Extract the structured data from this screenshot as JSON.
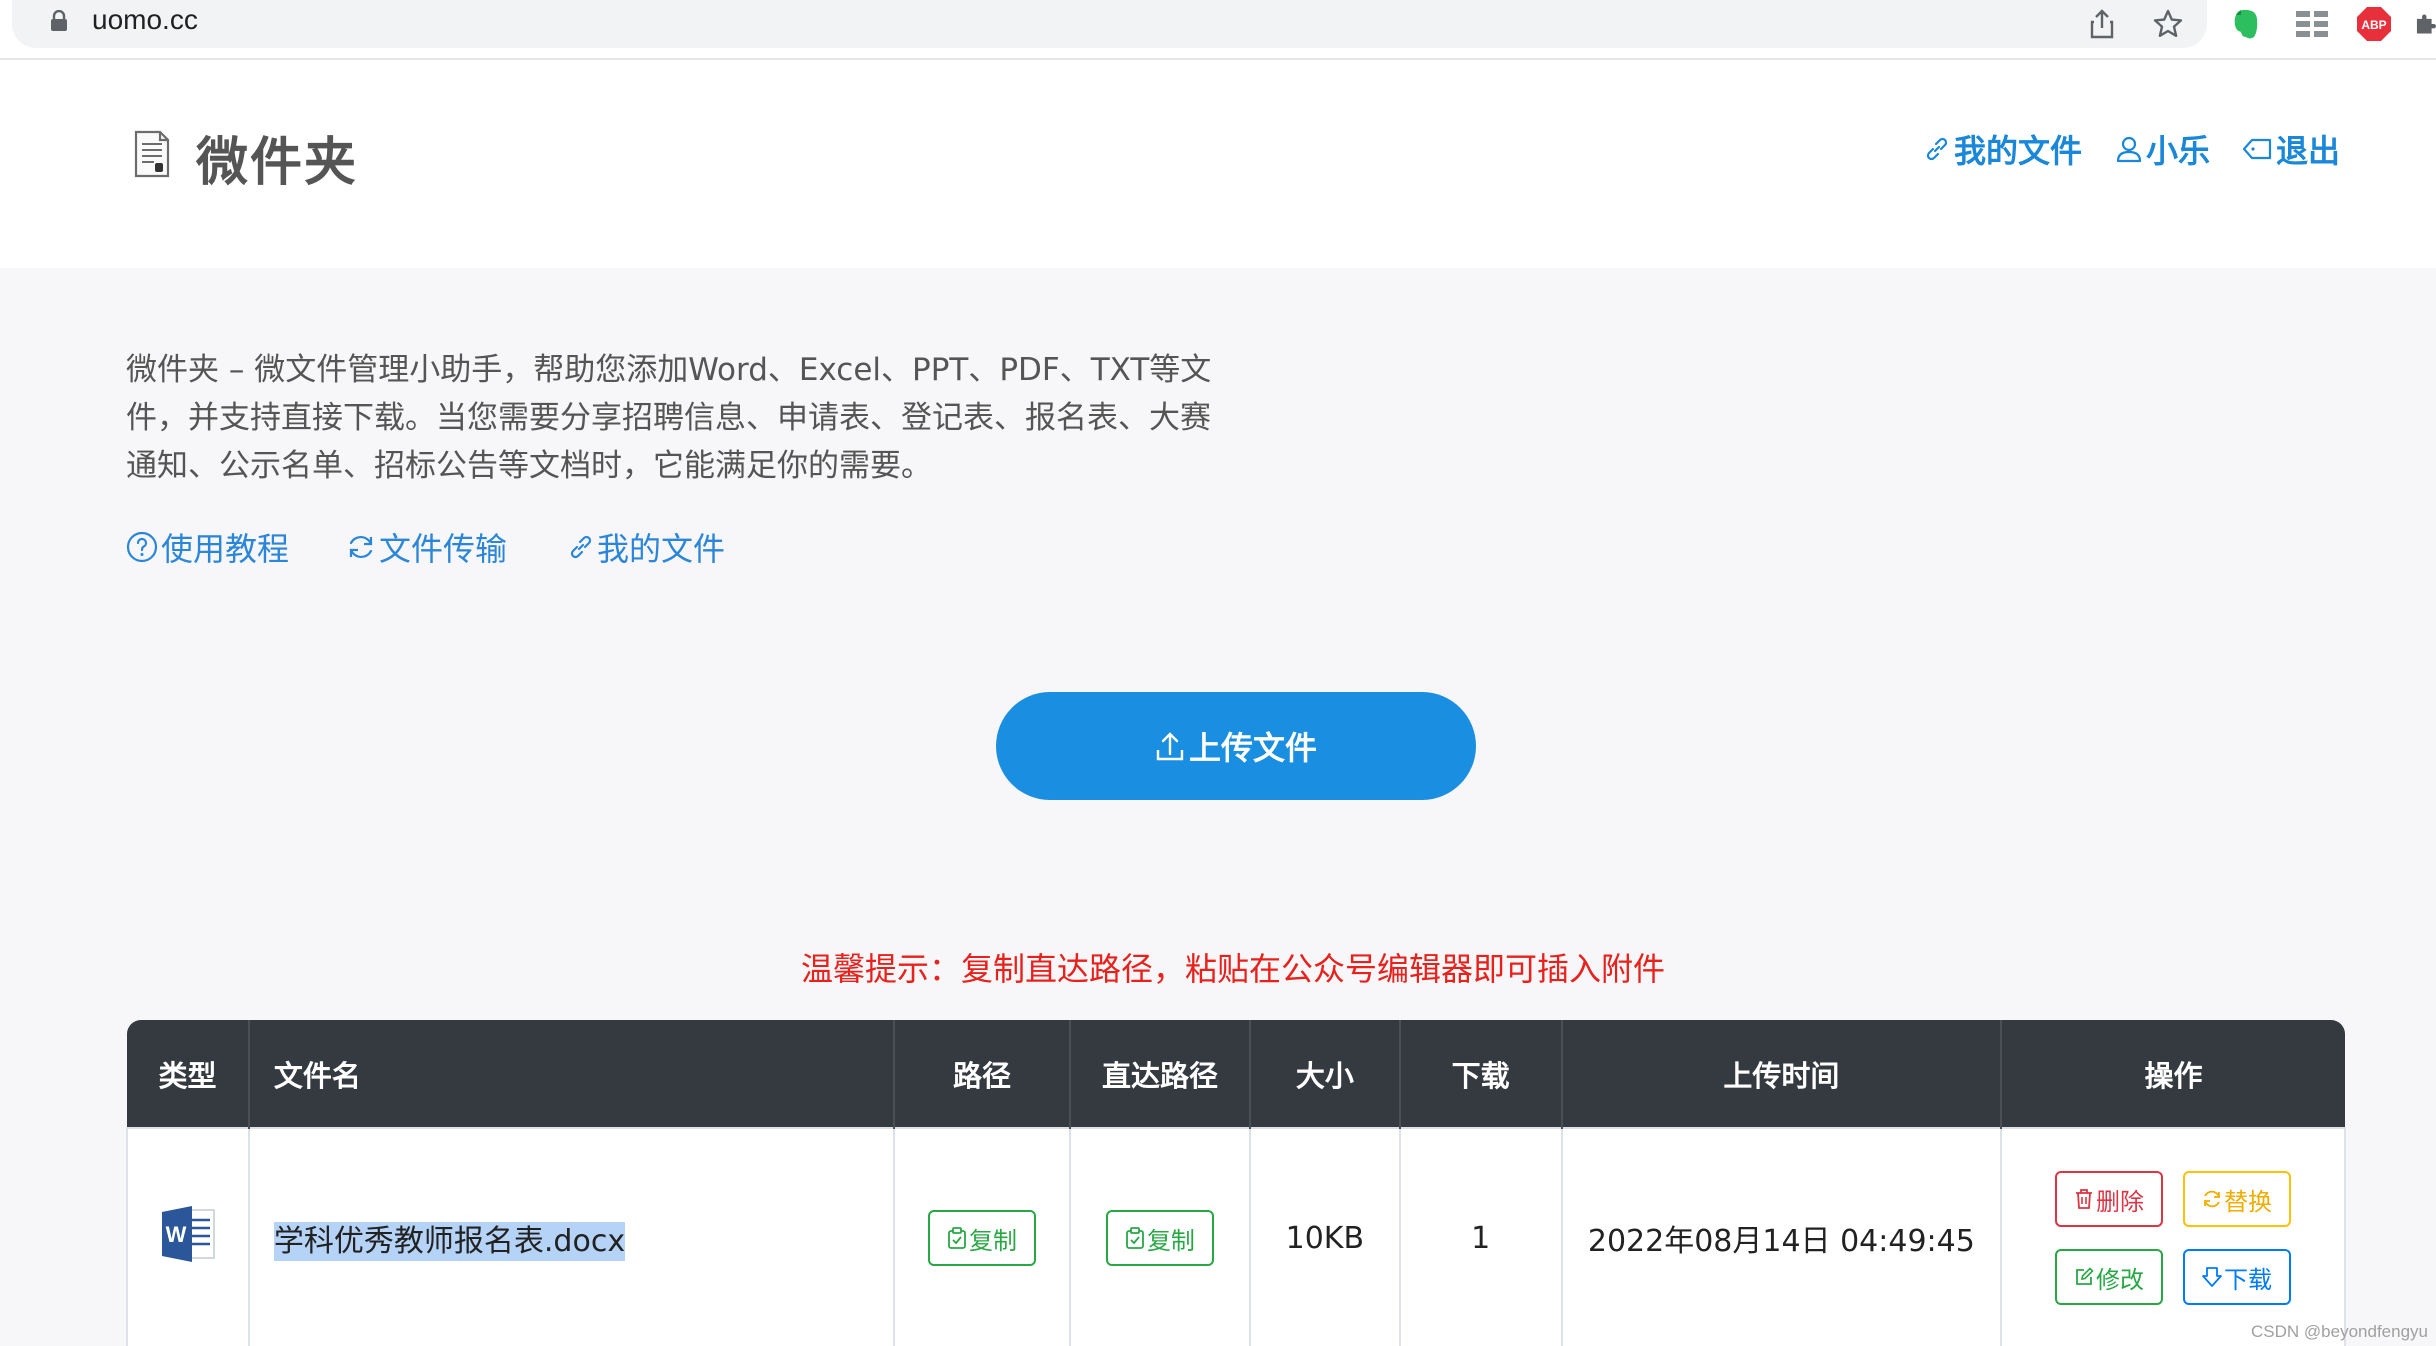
{
  "browser": {
    "url": "uomo.cc"
  },
  "header": {
    "title": "微件夹",
    "nav": {
      "my_files": "我的文件",
      "user": "小乐",
      "logout": "退出"
    }
  },
  "intro": {
    "description": "微件夹 – 微文件管理小助手，帮助您添加Word、Excel、PPT、PDF、TXT等文件，并支持直接下载。当您需要分享招聘信息、申请表、登记表、报名表、大赛通知、公示名单、招标公告等文档时，它能满足你的需要。",
    "links": {
      "tutorial": "使用教程",
      "transfer": "文件传输",
      "my_files": "我的文件"
    }
  },
  "upload": {
    "label": "上传文件"
  },
  "tip": "温馨提示：复制直达路径，粘贴在公众号编辑器即可插入附件",
  "table": {
    "headers": {
      "type": "类型",
      "filename": "文件名",
      "path": "路径",
      "direct_path": "直达路径",
      "size": "大小",
      "downloads": "下载",
      "upload_time": "上传时间",
      "actions": "操作"
    },
    "rows": [
      {
        "type_icon": "word-icon",
        "filename": "学科优秀教师报名表.docx",
        "copy_path": "复制",
        "copy_direct": "复制",
        "size": "10KB",
        "downloads": "1",
        "upload_time": "2022年08月14日 04:49:45",
        "actions": {
          "delete": "删除",
          "replace": "替换",
          "edit": "修改",
          "download": "下载"
        }
      }
    ]
  },
  "watermark": "CSDN @beyondfengyu",
  "colors": {
    "accent_blue": "#1a8ee0",
    "tip_red": "#e8211c",
    "table_header": "#343a40"
  }
}
